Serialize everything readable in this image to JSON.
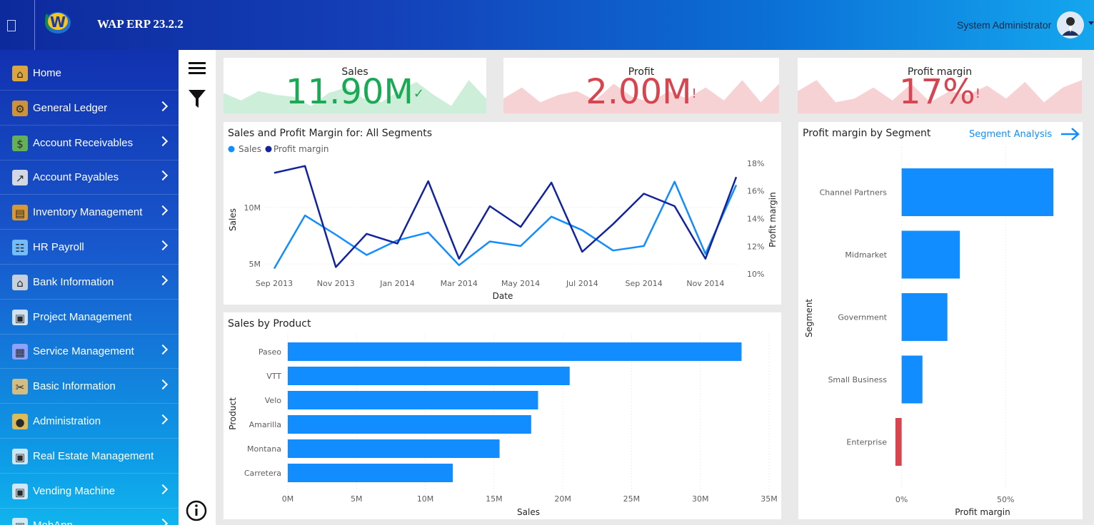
{
  "app": {
    "title": "WAP ERP 23.2.2",
    "user_name": "System Administrator"
  },
  "sidebar": {
    "items": [
      {
        "label": "Home",
        "icon": "home-icon",
        "has_arrow": false
      },
      {
        "label": "General Ledger",
        "icon": "ledger-icon",
        "has_arrow": true
      },
      {
        "label": "Account Receivables",
        "icon": "receivables-icon",
        "has_arrow": true
      },
      {
        "label": "Account Payables",
        "icon": "payables-icon",
        "has_arrow": true
      },
      {
        "label": "Inventory Management",
        "icon": "inventory-icon",
        "has_arrow": true
      },
      {
        "label": "HR Payroll",
        "icon": "payroll-icon",
        "has_arrow": true
      },
      {
        "label": "Bank Information",
        "icon": "bank-icon",
        "has_arrow": true
      },
      {
        "label": "Project Management",
        "icon": "broken-image-icon",
        "has_arrow": false
      },
      {
        "label": "Service Management",
        "icon": "service-icon",
        "has_arrow": true
      },
      {
        "label": "Basic Information",
        "icon": "tools-icon",
        "has_arrow": true
      },
      {
        "label": "Administration",
        "icon": "administration-icon",
        "has_arrow": true
      },
      {
        "label": "Real Estate Management",
        "icon": "broken-image-icon",
        "has_arrow": false
      },
      {
        "label": "Vending Machine",
        "icon": "broken-image-icon",
        "has_arrow": true
      },
      {
        "label": "MobApp",
        "icon": "broken-image-icon",
        "has_arrow": true
      }
    ]
  },
  "kpis": [
    {
      "title": "Sales",
      "value": "11.90M",
      "status": "✓",
      "color": "#1aaa55",
      "spark": "#cdeed8"
    },
    {
      "title": "Profit",
      "value": "2.00M",
      "status": "!",
      "color": "#d64550",
      "spark": "#f7d2d5"
    },
    {
      "title": "Profit margin",
      "value": "17%",
      "status": "!",
      "color": "#d64550",
      "spark": "#f7d2d5"
    }
  ],
  "colors": {
    "sales": "#118dff",
    "profit_margin": "#12239e",
    "negative": "#d64550"
  },
  "chart_data": [
    {
      "type": "line",
      "title": "Sales and Profit Margin for: All Segments",
      "xlabel": "Date",
      "ylabel": "Sales",
      "y2label": "Profit margin",
      "x": [
        "Sep 2013",
        "Oct 2013",
        "Nov 2013",
        "Dec 2013",
        "Jan 2014",
        "Feb 2014",
        "Mar 2014",
        "Apr 2014",
        "May 2014",
        "Jun 2014",
        "Jul 2014",
        "Aug 2014",
        "Sep 2014",
        "Oct 2014",
        "Nov 2014",
        "Dec 2014"
      ],
      "x_ticks": [
        "Sep 2013",
        "Nov 2013",
        "Jan 2014",
        "Mar 2014",
        "May 2014",
        "Jul 2014",
        "Sep 2014",
        "Nov 2014"
      ],
      "y_ticks": [
        "5M",
        "10M"
      ],
      "y2_ticks": [
        "10%",
        "12%",
        "14%",
        "16%",
        "18%"
      ],
      "ylim": [
        4,
        14.3
      ],
      "y2lim": [
        9.9,
        18.3
      ],
      "series": [
        {
          "name": "Sales",
          "axis": "left",
          "values": [
            4.6,
            9.3,
            7.6,
            5.8,
            7.1,
            7.8,
            4.9,
            7.0,
            6.6,
            9.2,
            8.0,
            6.2,
            6.6,
            12.3,
            5.9,
            12.0
          ]
        },
        {
          "name": "Profit margin",
          "axis": "right",
          "values": [
            17.3,
            17.8,
            10.5,
            12.9,
            12.2,
            16.7,
            11.1,
            14.9,
            13.4,
            16.6,
            11.6,
            13.6,
            15.8,
            14.9,
            11.1,
            17.0
          ]
        }
      ]
    },
    {
      "type": "bar",
      "orientation": "horizontal",
      "title": "Sales by Product",
      "xlabel": "Sales",
      "ylabel": "Product",
      "categories": [
        "Paseo",
        "VTT",
        "Velo",
        "Amarilla",
        "Montana",
        "Carretera"
      ],
      "values": [
        33.0,
        20.5,
        18.2,
        17.7,
        15.4,
        12.0
      ],
      "x_ticks": [
        "0M",
        "5M",
        "10M",
        "15M",
        "20M",
        "25M",
        "30M",
        "35M"
      ],
      "xlim": [
        0,
        35
      ]
    },
    {
      "type": "bar",
      "orientation": "horizontal",
      "title": "Profit margin by Segment",
      "link_label": "Segment Analysis",
      "xlabel": "Profit margin",
      "ylabel": "Segment",
      "categories": [
        "Channel Partners",
        "Midmarket",
        "Government",
        "Small Business",
        "Enterprise"
      ],
      "values": [
        73,
        28,
        22,
        10,
        -3
      ],
      "x_ticks": [
        "0%",
        "50%"
      ],
      "xlim": [
        -4,
        75
      ]
    }
  ]
}
